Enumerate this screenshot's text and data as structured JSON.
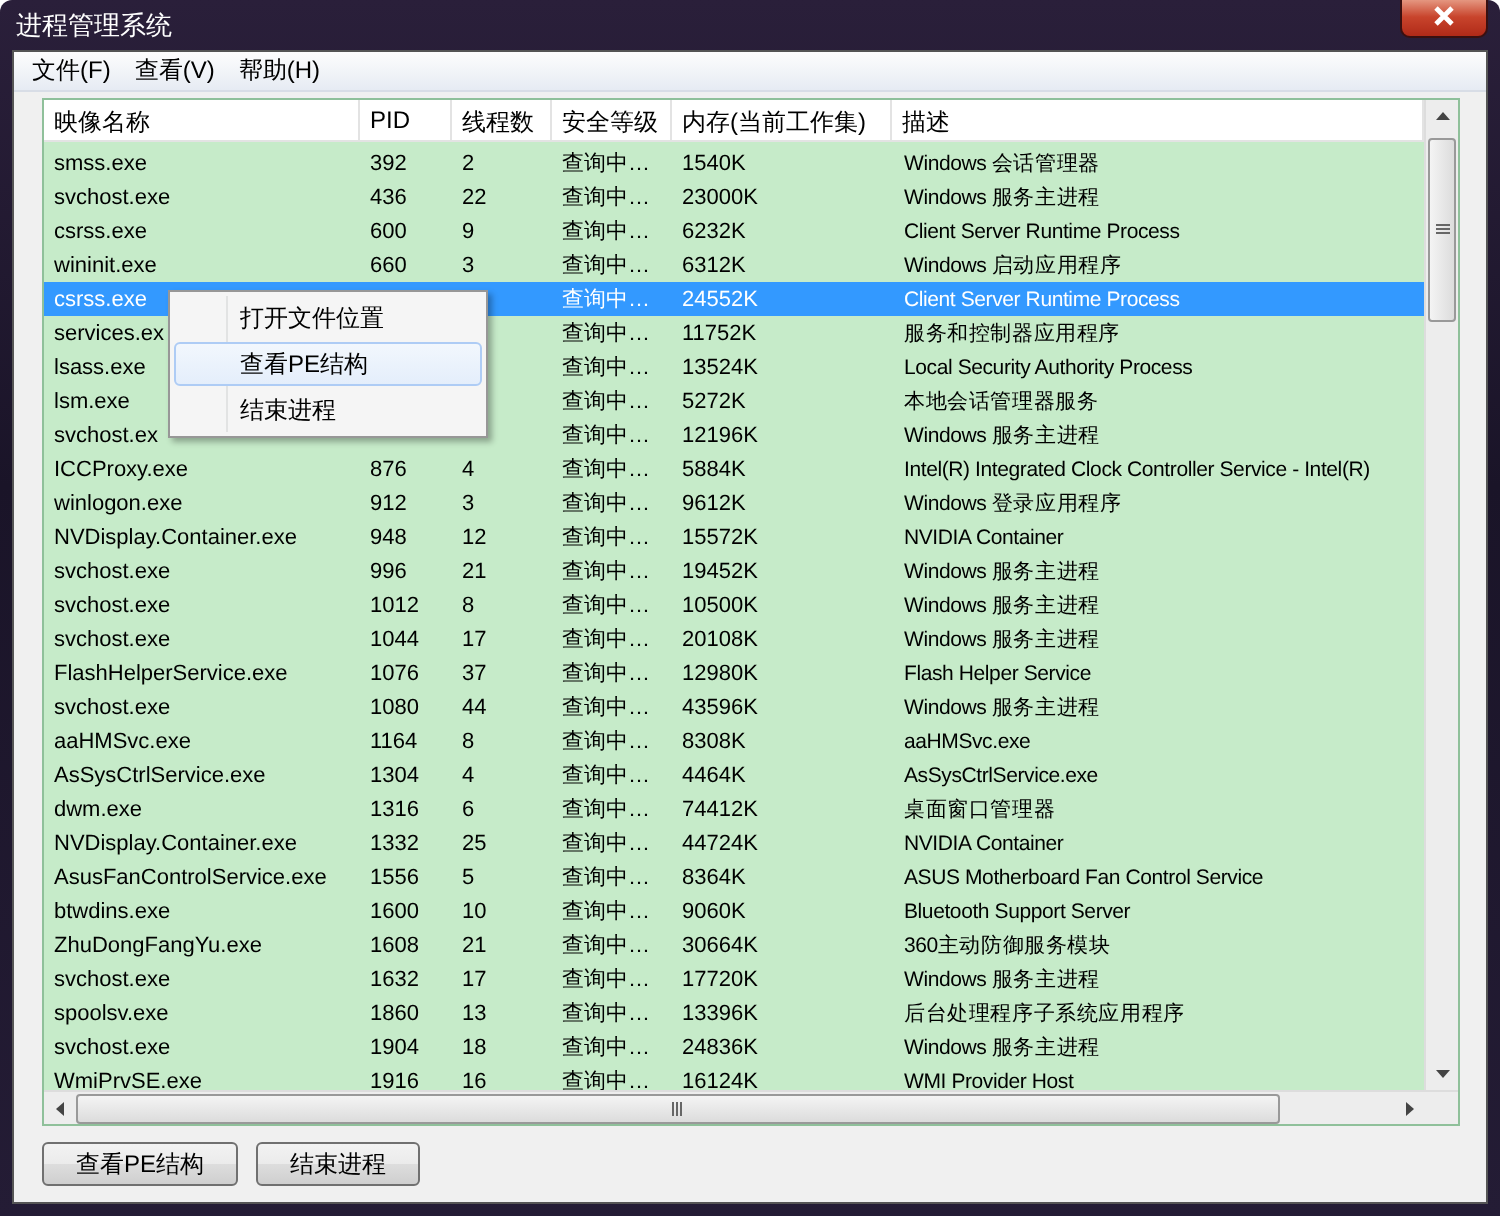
{
  "window": {
    "title": "进程管理系统"
  },
  "menu_bar": [
    {
      "label": "文件(F)"
    },
    {
      "label": "查看(V)"
    },
    {
      "label": "帮助(H)"
    }
  ],
  "table": {
    "columns": [
      "映像名称",
      "PID",
      "线程数",
      "安全等级",
      "内存(当前工作集)",
      "描述"
    ],
    "rows": [
      {
        "cells": [
          "smss.exe",
          "392",
          "2",
          "查询中…",
          "1540K",
          "Windows 会话管理器"
        ],
        "selected": false
      },
      {
        "cells": [
          "svchost.exe",
          "436",
          "22",
          "查询中…",
          "23000K",
          "Windows 服务主进程"
        ],
        "selected": false
      },
      {
        "cells": [
          "csrss.exe",
          "600",
          "9",
          "查询中…",
          "6232K",
          "Client Server Runtime Process"
        ],
        "selected": false
      },
      {
        "cells": [
          "wininit.exe",
          "660",
          "3",
          "查询中…",
          "6312K",
          "Windows 启动应用程序"
        ],
        "selected": false
      },
      {
        "cells": [
          "csrss.exe",
          null,
          null,
          "查询中…",
          "24552K",
          "Client Server Runtime Process"
        ],
        "selected": true
      },
      {
        "cells": [
          "services.ex",
          null,
          null,
          "查询中…",
          "11752K",
          "服务和控制器应用程序"
        ],
        "selected": false
      },
      {
        "cells": [
          "lsass.exe",
          null,
          null,
          "查询中…",
          "13524K",
          "Local Security Authority Process"
        ],
        "selected": false
      },
      {
        "cells": [
          "lsm.exe",
          null,
          null,
          "查询中…",
          "5272K",
          "本地会话管理器服务"
        ],
        "selected": false
      },
      {
        "cells": [
          "svchost.ex",
          null,
          null,
          "查询中…",
          "12196K",
          "Windows 服务主进程"
        ],
        "selected": false
      },
      {
        "cells": [
          "ICCProxy.exe",
          "876",
          "4",
          "查询中…",
          "5884K",
          "Intel(R) Integrated Clock Controller Service - Intel(R)"
        ],
        "selected": false
      },
      {
        "cells": [
          "winlogon.exe",
          "912",
          "3",
          "查询中…",
          "9612K",
          "Windows 登录应用程序"
        ],
        "selected": false
      },
      {
        "cells": [
          "NVDisplay.Container.exe",
          "948",
          "12",
          "查询中…",
          "15572K",
          "NVIDIA Container"
        ],
        "selected": false
      },
      {
        "cells": [
          "svchost.exe",
          "996",
          "21",
          "查询中…",
          "19452K",
          "Windows 服务主进程"
        ],
        "selected": false
      },
      {
        "cells": [
          "svchost.exe",
          "1012",
          "8",
          "查询中…",
          "10500K",
          "Windows 服务主进程"
        ],
        "selected": false
      },
      {
        "cells": [
          "svchost.exe",
          "1044",
          "17",
          "查询中…",
          "20108K",
          "Windows 服务主进程"
        ],
        "selected": false
      },
      {
        "cells": [
          "FlashHelperService.exe",
          "1076",
          "37",
          "查询中…",
          "12980K",
          "Flash Helper Service"
        ],
        "selected": false
      },
      {
        "cells": [
          "svchost.exe",
          "1080",
          "44",
          "查询中…",
          "43596K",
          "Windows 服务主进程"
        ],
        "selected": false
      },
      {
        "cells": [
          "aaHMSvc.exe",
          "1164",
          "8",
          "查询中…",
          "8308K",
          "aaHMSvc.exe"
        ],
        "selected": false
      },
      {
        "cells": [
          "AsSysCtrlService.exe",
          "1304",
          "4",
          "查询中…",
          "4464K",
          "AsSysCtrlService.exe"
        ],
        "selected": false
      },
      {
        "cells": [
          "dwm.exe",
          "1316",
          "6",
          "查询中…",
          "74412K",
          "桌面窗口管理器"
        ],
        "selected": false
      },
      {
        "cells": [
          "NVDisplay.Container.exe",
          "1332",
          "25",
          "查询中…",
          "44724K",
          "NVIDIA Container"
        ],
        "selected": false
      },
      {
        "cells": [
          "AsusFanControlService.exe",
          "1556",
          "5",
          "查询中…",
          "8364K",
          "ASUS Motherboard Fan Control Service"
        ],
        "selected": false
      },
      {
        "cells": [
          "btwdins.exe",
          "1600",
          "10",
          "查询中…",
          "9060K",
          "Bluetooth Support Server"
        ],
        "selected": false
      },
      {
        "cells": [
          "ZhuDongFangYu.exe",
          "1608",
          "21",
          "查询中…",
          "30664K",
          "360主动防御服务模块"
        ],
        "selected": false
      },
      {
        "cells": [
          "svchost.exe",
          "1632",
          "17",
          "查询中…",
          "17720K",
          "Windows 服务主进程"
        ],
        "selected": false
      },
      {
        "cells": [
          "spoolsv.exe",
          "1860",
          "13",
          "查询中…",
          "13396K",
          "后台处理程序子系统应用程序"
        ],
        "selected": false
      },
      {
        "cells": [
          "svchost.exe",
          "1904",
          "18",
          "查询中…",
          "24836K",
          "Windows 服务主进程"
        ],
        "selected": false
      },
      {
        "cells": [
          "WmiPrvSE.exe",
          "1916",
          "16",
          "查询中…",
          "16124K",
          "WMI Provider Host"
        ],
        "selected": false
      }
    ]
  },
  "context_menu": {
    "items": [
      {
        "label": "打开文件位置",
        "selected": false
      },
      {
        "label": "查看PE结构",
        "selected": true
      },
      {
        "label": "结束进程",
        "selected": false
      }
    ]
  },
  "buttons": [
    {
      "label": "查看PE结构"
    },
    {
      "label": "结束进程"
    }
  ]
}
